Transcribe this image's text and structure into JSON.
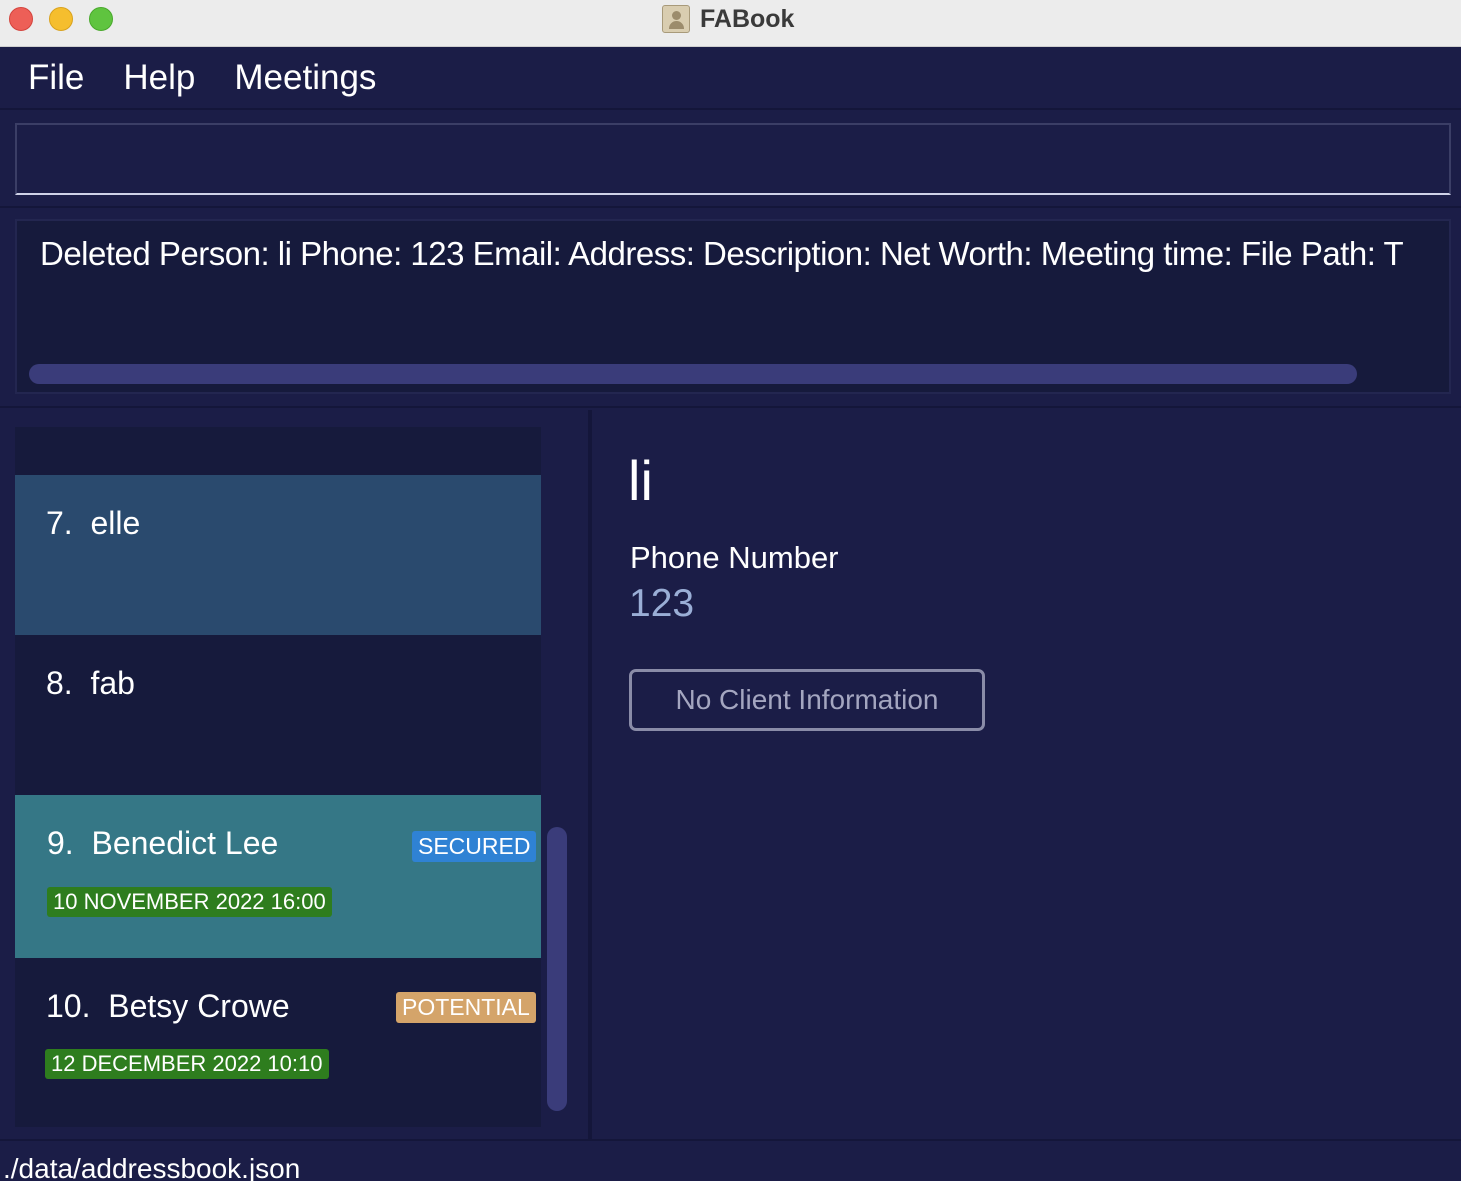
{
  "window": {
    "title": "FABook",
    "app_icon": "address-book-icon"
  },
  "menu": [
    "File",
    "Help",
    "Meetings"
  ],
  "command_box": {
    "value": "",
    "placeholder": ""
  },
  "result": {
    "text": "Deleted Person: li Phone: 123 Email:  Address:  Description:  Net Worth:  Meeting time:  File Path:  T"
  },
  "person_list": [
    {
      "index": "7.",
      "name": "elle",
      "tag": "",
      "date": "",
      "bg": "#2a4a6e"
    },
    {
      "index": "8.",
      "name": "fab",
      "tag": "",
      "date": "",
      "bg": "#161a3c"
    },
    {
      "index": "9.",
      "name": "Benedict Lee",
      "tag": "SECURED",
      "date": "10 NOVEMBER 2022 16:00",
      "bg": "#357786"
    },
    {
      "index": "10.",
      "name": "Betsy Crowe",
      "tag": "POTENTIAL",
      "date": "12 DECEMBER 2022 10:10",
      "bg": "#161a3c"
    }
  ],
  "detail": {
    "name": "li",
    "phone_label": "Phone Number",
    "phone_value": "123",
    "button_label": "No Client Information"
  },
  "status": {
    "file_path": "./data/addressbook.json"
  },
  "colors": {
    "background": "#1b1d47",
    "secured": "#2f82d4",
    "potential": "#d4a46a",
    "date_badge": "#2e7d1e"
  }
}
